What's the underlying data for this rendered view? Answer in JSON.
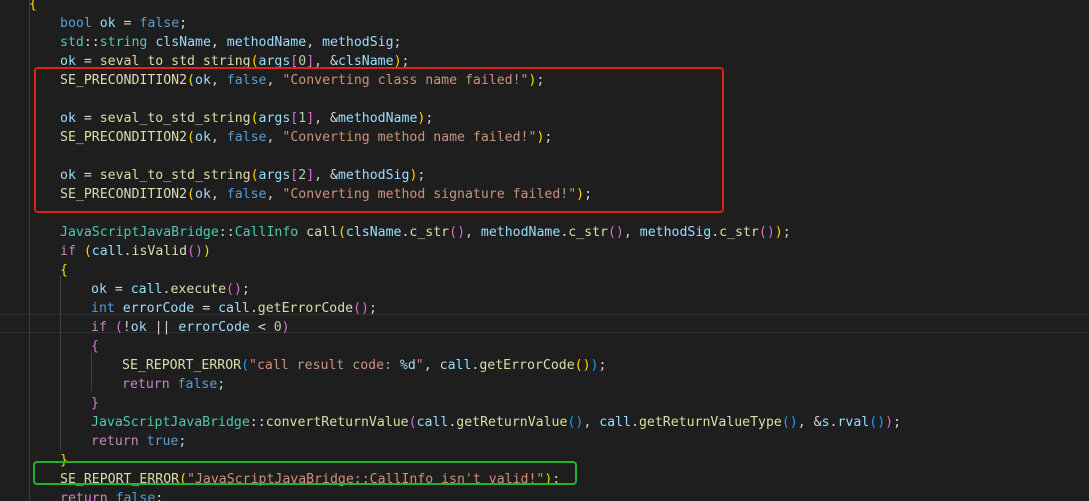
{
  "editor": {
    "lines": [
      {
        "indent": 0,
        "tokens": [
          [
            "br1",
            "{"
          ]
        ]
      },
      {
        "indent": 1,
        "tokens": [
          [
            "kw",
            "bool"
          ],
          [
            "pl",
            " "
          ],
          [
            "var",
            "ok"
          ],
          [
            "pl",
            " = "
          ],
          [
            "kw",
            "false"
          ],
          [
            "pl",
            ";"
          ]
        ]
      },
      {
        "indent": 1,
        "tokens": [
          [
            "ty",
            "std"
          ],
          [
            "pl",
            "::"
          ],
          [
            "ty",
            "string"
          ],
          [
            "pl",
            " "
          ],
          [
            "var",
            "clsName"
          ],
          [
            "pl",
            ", "
          ],
          [
            "var",
            "methodName"
          ],
          [
            "pl",
            ", "
          ],
          [
            "var",
            "methodSig"
          ],
          [
            "pl",
            ";"
          ]
        ]
      },
      {
        "indent": 1,
        "tokens": [
          [
            "var",
            "ok"
          ],
          [
            "pl",
            " = "
          ],
          [
            "fn",
            "seval_to_std_string"
          ],
          [
            "br1",
            "("
          ],
          [
            "var",
            "args"
          ],
          [
            "br2",
            "["
          ],
          [
            "num",
            "0"
          ],
          [
            "br2",
            "]"
          ],
          [
            "pl",
            ", &"
          ],
          [
            "var",
            "clsName"
          ],
          [
            "br1",
            ")"
          ],
          [
            "pl",
            ";"
          ]
        ]
      },
      {
        "indent": 1,
        "tokens": [
          [
            "mac",
            "SE_PRECONDITION2"
          ],
          [
            "br1",
            "("
          ],
          [
            "var",
            "ok"
          ],
          [
            "pl",
            ", "
          ],
          [
            "kw",
            "false"
          ],
          [
            "pl",
            ", "
          ],
          [
            "str",
            "\"Converting class name failed!\""
          ],
          [
            "br1",
            ")"
          ],
          [
            "pl",
            ";"
          ]
        ]
      },
      {
        "indent": 0,
        "tokens": []
      },
      {
        "indent": 1,
        "tokens": [
          [
            "var",
            "ok"
          ],
          [
            "pl",
            " = "
          ],
          [
            "fn",
            "seval_to_std_string"
          ],
          [
            "br1",
            "("
          ],
          [
            "var",
            "args"
          ],
          [
            "br2",
            "["
          ],
          [
            "num",
            "1"
          ],
          [
            "br2",
            "]"
          ],
          [
            "pl",
            ", &"
          ],
          [
            "var",
            "methodName"
          ],
          [
            "br1",
            ")"
          ],
          [
            "pl",
            ";"
          ]
        ]
      },
      {
        "indent": 1,
        "tokens": [
          [
            "mac",
            "SE_PRECONDITION2"
          ],
          [
            "br1",
            "("
          ],
          [
            "var",
            "ok"
          ],
          [
            "pl",
            ", "
          ],
          [
            "kw",
            "false"
          ],
          [
            "pl",
            ", "
          ],
          [
            "str",
            "\"Converting method name failed!\""
          ],
          [
            "br1",
            ")"
          ],
          [
            "pl",
            ";"
          ]
        ]
      },
      {
        "indent": 0,
        "tokens": []
      },
      {
        "indent": 1,
        "tokens": [
          [
            "var",
            "ok"
          ],
          [
            "pl",
            " = "
          ],
          [
            "fn",
            "seval_to_std_string"
          ],
          [
            "br1",
            "("
          ],
          [
            "var",
            "args"
          ],
          [
            "br2",
            "["
          ],
          [
            "num",
            "2"
          ],
          [
            "br2",
            "]"
          ],
          [
            "pl",
            ", &"
          ],
          [
            "var",
            "methodSig"
          ],
          [
            "br1",
            ")"
          ],
          [
            "pl",
            ";"
          ]
        ]
      },
      {
        "indent": 1,
        "tokens": [
          [
            "mac",
            "SE_PRECONDITION2"
          ],
          [
            "br1",
            "("
          ],
          [
            "var",
            "ok"
          ],
          [
            "pl",
            ", "
          ],
          [
            "kw",
            "false"
          ],
          [
            "pl",
            ", "
          ],
          [
            "str",
            "\"Converting method signature failed!\""
          ],
          [
            "br1",
            ")"
          ],
          [
            "pl",
            ";"
          ]
        ]
      },
      {
        "indent": 0,
        "tokens": []
      },
      {
        "indent": 1,
        "tokens": [
          [
            "ty",
            "JavaScriptJavaBridge"
          ],
          [
            "pl",
            "::"
          ],
          [
            "ty",
            "CallInfo"
          ],
          [
            "pl",
            " "
          ],
          [
            "fn",
            "call"
          ],
          [
            "br1",
            "("
          ],
          [
            "var",
            "clsName"
          ],
          [
            "pl",
            "."
          ],
          [
            "fn",
            "c_str"
          ],
          [
            "br2",
            "()"
          ],
          [
            "pl",
            ", "
          ],
          [
            "var",
            "methodName"
          ],
          [
            "pl",
            "."
          ],
          [
            "fn",
            "c_str"
          ],
          [
            "br2",
            "()"
          ],
          [
            "pl",
            ", "
          ],
          [
            "var",
            "methodSig"
          ],
          [
            "pl",
            "."
          ],
          [
            "fn",
            "c_str"
          ],
          [
            "br2",
            "()"
          ],
          [
            "br1",
            ")"
          ],
          [
            "pl",
            ";"
          ]
        ]
      },
      {
        "indent": 1,
        "tokens": [
          [
            "ctl",
            "if"
          ],
          [
            "pl",
            " "
          ],
          [
            "br1",
            "("
          ],
          [
            "var",
            "call"
          ],
          [
            "pl",
            "."
          ],
          [
            "fn",
            "isValid"
          ],
          [
            "br2",
            "()"
          ],
          [
            "br1",
            ")"
          ]
        ]
      },
      {
        "indent": 1,
        "tokens": [
          [
            "br1",
            "{"
          ]
        ]
      },
      {
        "indent": 2,
        "tokens": [
          [
            "var",
            "ok"
          ],
          [
            "pl",
            " = "
          ],
          [
            "var",
            "call"
          ],
          [
            "pl",
            "."
          ],
          [
            "fn",
            "execute"
          ],
          [
            "br2",
            "()"
          ],
          [
            "pl",
            ";"
          ]
        ]
      },
      {
        "indent": 2,
        "tokens": [
          [
            "kw",
            "int"
          ],
          [
            "pl",
            " "
          ],
          [
            "var",
            "errorCode"
          ],
          [
            "pl",
            " = "
          ],
          [
            "var",
            "call"
          ],
          [
            "pl",
            "."
          ],
          [
            "fn",
            "getErrorCode"
          ],
          [
            "br2",
            "()"
          ],
          [
            "pl",
            ";"
          ]
        ]
      },
      {
        "indent": 2,
        "tokens": [
          [
            "ctl",
            "if"
          ],
          [
            "pl",
            " "
          ],
          [
            "br2",
            "("
          ],
          [
            "pl",
            "!"
          ],
          [
            "var",
            "ok"
          ],
          [
            "pl",
            " || "
          ],
          [
            "var",
            "errorCode"
          ],
          [
            "pl",
            " < "
          ],
          [
            "num",
            "0"
          ],
          [
            "br2",
            ")"
          ]
        ]
      },
      {
        "indent": 2,
        "tokens": [
          [
            "br2",
            "{"
          ]
        ]
      },
      {
        "indent": 3,
        "tokens": [
          [
            "mac",
            "SE_REPORT_ERROR"
          ],
          [
            "br3",
            "("
          ],
          [
            "str",
            "\"call result code: "
          ],
          [
            "var",
            "%d"
          ],
          [
            "str",
            "\""
          ],
          [
            "pl",
            ", "
          ],
          [
            "var",
            "call"
          ],
          [
            "pl",
            "."
          ],
          [
            "fn",
            "getErrorCode"
          ],
          [
            "br1",
            "()"
          ],
          [
            "br3",
            ")"
          ],
          [
            "pl",
            ";"
          ]
        ]
      },
      {
        "indent": 3,
        "tokens": [
          [
            "ctl",
            "return"
          ],
          [
            "pl",
            " "
          ],
          [
            "kw",
            "false"
          ],
          [
            "pl",
            ";"
          ]
        ]
      },
      {
        "indent": 2,
        "tokens": [
          [
            "br2",
            "}"
          ]
        ]
      },
      {
        "indent": 2,
        "tokens": [
          [
            "ty",
            "JavaScriptJavaBridge"
          ],
          [
            "pl",
            "::"
          ],
          [
            "fn",
            "convertReturnValue"
          ],
          [
            "br2",
            "("
          ],
          [
            "var",
            "call"
          ],
          [
            "pl",
            "."
          ],
          [
            "fn",
            "getReturnValue"
          ],
          [
            "br3",
            "()"
          ],
          [
            "pl",
            ", "
          ],
          [
            "var",
            "call"
          ],
          [
            "pl",
            "."
          ],
          [
            "fn",
            "getReturnValueType"
          ],
          [
            "br3",
            "()"
          ],
          [
            "pl",
            ", &"
          ],
          [
            "var",
            "s"
          ],
          [
            "pl",
            "."
          ],
          [
            "var",
            "rval"
          ],
          [
            "br3",
            "()"
          ],
          [
            "br2",
            ")"
          ],
          [
            "pl",
            ";"
          ]
        ]
      },
      {
        "indent": 2,
        "tokens": [
          [
            "ctl",
            "return"
          ],
          [
            "pl",
            " "
          ],
          [
            "kw",
            "true"
          ],
          [
            "pl",
            ";"
          ]
        ]
      },
      {
        "indent": 1,
        "tokens": [
          [
            "br1",
            "}"
          ]
        ]
      },
      {
        "indent": 1,
        "tokens": [
          [
            "mac",
            "SE_REPORT_ERROR"
          ],
          [
            "br1",
            "("
          ],
          [
            "str",
            "\"JavaScriptJavaBridge::CallInfo isn't valid!\""
          ],
          [
            "br1",
            ")"
          ],
          [
            "pl",
            ";"
          ]
        ]
      },
      {
        "indent": 1,
        "tokens": [
          [
            "ctl",
            "return"
          ],
          [
            "pl",
            " "
          ],
          [
            "kw",
            "false"
          ],
          [
            "pl",
            ";"
          ]
        ]
      }
    ],
    "annotation_colors": {
      "red_box": "#e0201a",
      "green_box": "#20b033"
    },
    "background": "#1e1e1e"
  }
}
